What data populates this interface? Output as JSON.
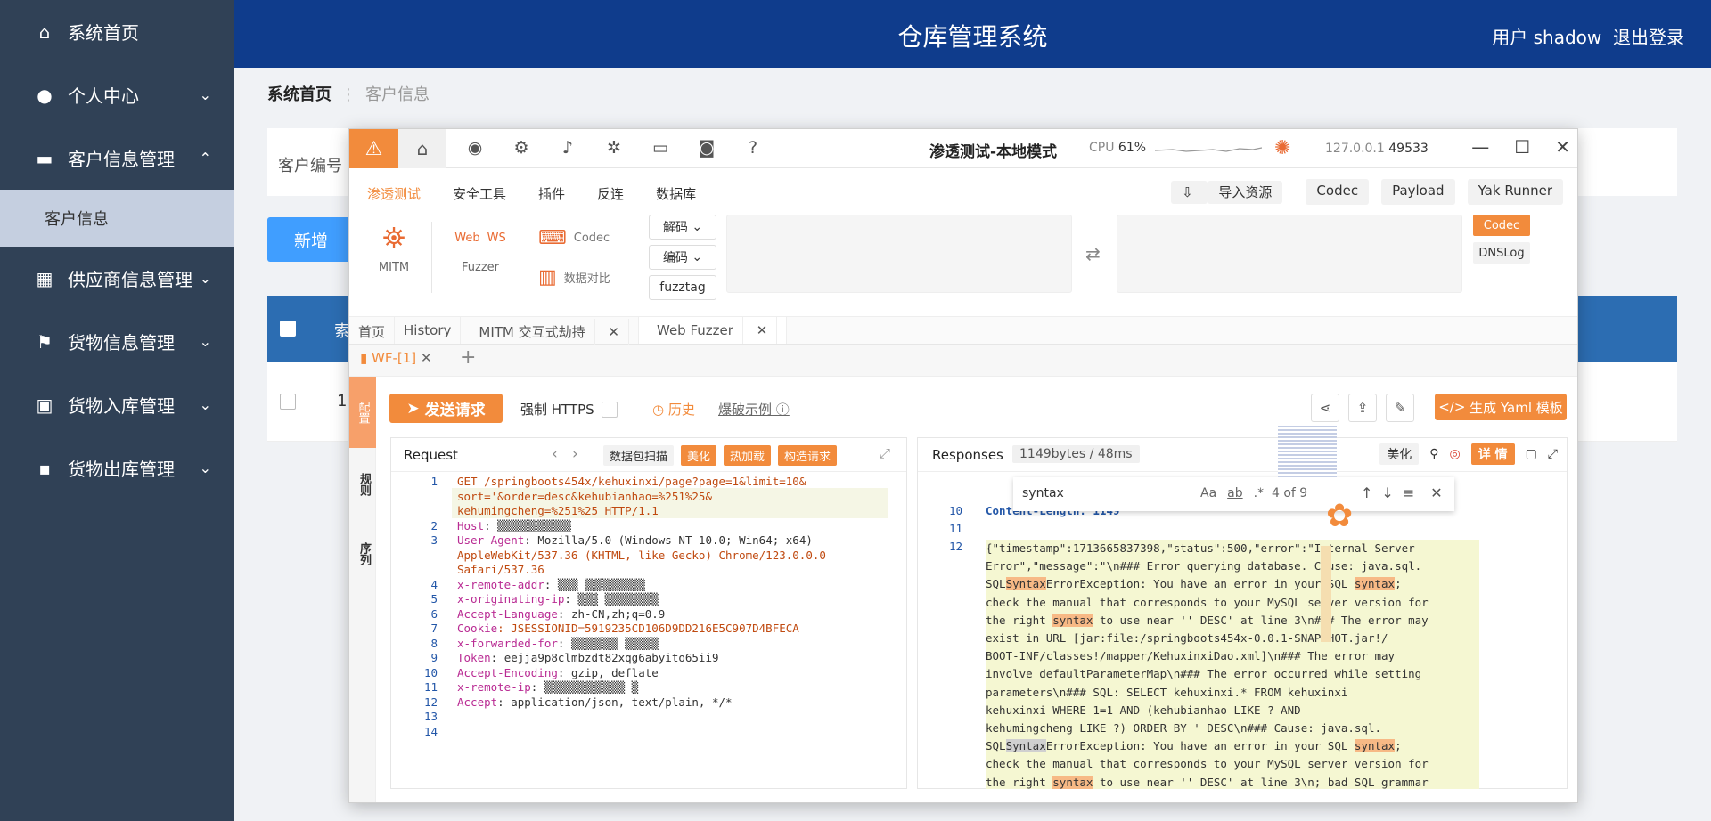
{
  "sidebar": {
    "items": [
      {
        "label": "系统首页"
      },
      {
        "label": "个人中心"
      },
      {
        "label": "客户信息管理"
      },
      {
        "label": "客户信息"
      },
      {
        "label": "供应商信息管理"
      },
      {
        "label": "货物信息管理"
      },
      {
        "label": "货物入库管理"
      },
      {
        "label": "货物出库管理"
      }
    ]
  },
  "header": {
    "title": "仓库管理系统",
    "user": "用户 shadow",
    "logout": "退出登录"
  },
  "breadcrumb": {
    "home": "系统首页",
    "current": "客户信息"
  },
  "search": {
    "label": "客户编号"
  },
  "toolbar": {
    "new_label": "新增"
  },
  "table": {
    "header_partial": "索",
    "row1_index": "1"
  },
  "yak": {
    "title": "渗透测试-本地模式",
    "cpu_label": "CPU",
    "cpu_value": "61%",
    "host": "127.0.0.1",
    "port": "49533",
    "menus": [
      "渗透测试",
      "安全工具",
      "插件",
      "反连",
      "数据库"
    ],
    "import_label": "导入资源",
    "codec": "Codec",
    "payload": "Payload",
    "runner": "Yak Runner",
    "tools": {
      "mitm": "MITM",
      "fuzzer": "Fuzzer",
      "web": "Web",
      "ws": "WS",
      "codec": "Codec",
      "compare": "数据对比"
    },
    "decode": "解码",
    "encode": "编码",
    "fuzztag": "fuzztag",
    "codec_tag": "Codec",
    "dnslog_tag": "DNSLog",
    "tabs": [
      "首页",
      "History",
      "MITM 交互式劫持",
      "Web Fuzzer"
    ],
    "subtab": "WF-[1]",
    "vside": [
      "配置",
      "规则",
      "序列"
    ],
    "send": "发送请求",
    "force_https": "强制 HTTPS",
    "history": "历史",
    "demo": "爆破示例",
    "yaml": "生成 Yaml 模板",
    "accent": "#f28b3c"
  },
  "request": {
    "title": "Request",
    "actions": [
      "数据包扫描",
      "美化",
      "热加载",
      "构造请求"
    ],
    "lines": [
      {
        "n": "1",
        "t": "GET /springboots454x/kehuxinxi/page?page=1&limit=10&"
      },
      {
        "n": "",
        "t": "sort='&order=desc&kehubianhao=%251%25&"
      },
      {
        "n": "",
        "t": "kehumingcheng=%251%25 HTTP/1.1"
      },
      {
        "n": "2",
        "t": "Host: ▒▒▒▒▒▒▒▒▒▒▒"
      },
      {
        "n": "3",
        "t": "User-Agent: Mozilla/5.0 (Windows NT 10.0; Win64; x64)"
      },
      {
        "n": "",
        "t": "AppleWebKit/537.36 (KHTML, like Gecko) Chrome/123.0.0.0"
      },
      {
        "n": "",
        "t": "Safari/537.36"
      },
      {
        "n": "4",
        "t": "x-remote-addr: ▒▒▒ ▒▒▒▒▒▒▒▒▒"
      },
      {
        "n": "5",
        "t": "x-originating-ip: ▒▒▒ ▒▒▒▒▒▒▒▒"
      },
      {
        "n": "6",
        "t": "Accept-Language: zh-CN,zh;q=0.9"
      },
      {
        "n": "7",
        "t": "Cookie: JSESSIONID=5919235CD106D9DD216E5C907D4BFECA"
      },
      {
        "n": "8",
        "t": "x-forwarded-for: ▒▒▒▒▒▒▒ ▒▒▒▒▒"
      },
      {
        "n": "9",
        "t": "Token: eejja9p8clmbzdt82xqg6abyito65ii9"
      },
      {
        "n": "10",
        "t": "Accept-Encoding: gzip, deflate"
      },
      {
        "n": "11",
        "t": "x-remote-ip: ▒▒▒▒▒▒▒▒▒▒▒▒ ▒"
      },
      {
        "n": "12",
        "t": "Accept: application/json, text/plain, */*"
      },
      {
        "n": "13",
        "t": ""
      },
      {
        "n": "14",
        "t": ""
      }
    ]
  },
  "response": {
    "title": "Responses",
    "meta": "1149bytes / 48ms",
    "beautify": "美化",
    "detail": "详 情",
    "find_query": "syntax",
    "find_count": "4 of 9",
    "find_opts": [
      "Aa",
      "ab",
      ".*"
    ],
    "head_lines": [
      {
        "n": "10",
        "t": "Content-Length: 1149"
      },
      {
        "n": "11",
        "t": ""
      },
      {
        "n": "12",
        "t": ""
      }
    ],
    "body": [
      "{\"timestamp\":1713665837398,\"status\":500,\"error\":\"Internal Server",
      "Error\",\"message\":\"\\n### Error querying database.  Cause: java.sql.",
      "SQLSyntaxErrorException: You have an error in your SQL syntax;",
      "check the manual that corresponds to your MySQL server version for",
      "the right syntax to use near '' DESC' at line 3\\n### The error may",
      "exist in URL [jar:file:/springboots454x-0.0.1-SNAPSHOT.jar!/",
      "BOOT-INF/classes!/mapper/KehuxinxiDao.xml]\\n### The error may",
      "involve defaultParameterMap\\n### The error occurred while setting",
      "parameters\\n### SQL: SELECT  kehuxinxi.* FROM kehuxinxi",
      "kehuxinxi                    WHERE 1=1 AND (kehubianhao LIKE ? AND",
      "kehumingcheng LIKE ?) ORDER BY ' DESC\\n### Cause: java.sql.",
      "SQLSyntaxErrorException: You have an error in your SQL syntax;",
      "check the manual that corresponds to your MySQL server version for",
      "the right syntax to use near '' DESC' at line 3\\n; bad SQL grammar"
    ]
  }
}
